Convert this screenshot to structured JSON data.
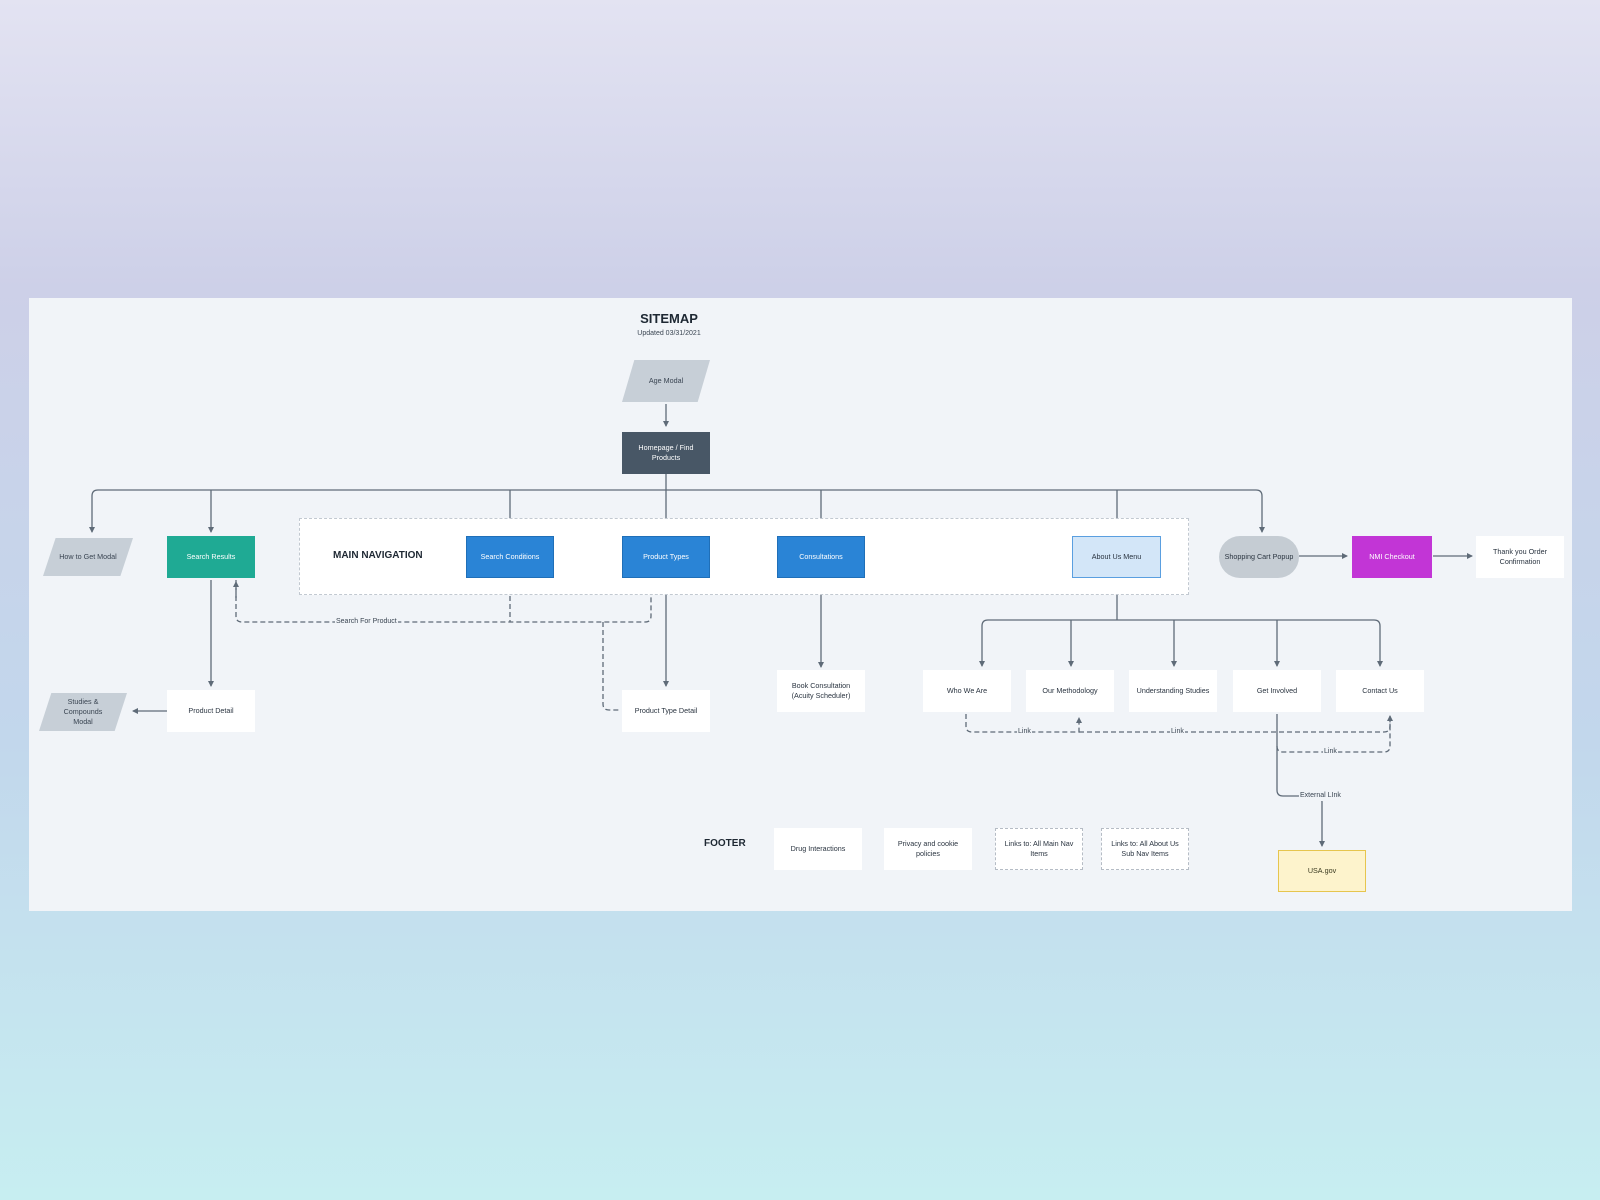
{
  "title": "SITEMAP",
  "subtitle": "Updated 03/31/2021",
  "main_navigation_label": "MAIN NAVIGATION",
  "footer_label": "FOOTER",
  "nodes": {
    "age_modal": "Age Modal",
    "homepage": "Homepage / Find Products",
    "how_to_get_modal": "How to Get Modal",
    "search_results": "Search Results",
    "search_conditions": "Search Conditions",
    "product_types": "Product Types",
    "consultations": "Consultations",
    "about_us_menu": "About Us Menu",
    "shopping_cart_popup": "Shopping Cart Popup",
    "nmi_checkout": "NMI Checkout",
    "thank_you": "Thank you Order Confirmation",
    "product_detail": "Product Detail",
    "studies_modal": "Studies & Compounds Modal",
    "product_type_detail": "Product Type Detail",
    "book_consultation": "Book Consultation (Acuity Scheduler)",
    "who_we_are": "Who We Are",
    "our_methodology": "Our Methodology",
    "understanding_studies": "Understanding Studies",
    "get_involved": "Get Involved",
    "contact_us": "Contact Us",
    "usa_gov": "USA.gov"
  },
  "footer_items": {
    "drug_interactions": "Drug Interactions",
    "privacy": "Privacy and cookie policies",
    "links_main_nav": "Links to: All Main Nav Items",
    "links_about_us": "Links to: All About Us Sub Nav Items"
  },
  "edge_labels": {
    "search_for_product": "Search For Product",
    "link_1": "Link",
    "link_2": "Link",
    "link_3": "Link",
    "external_link": "External LInk"
  },
  "colors": {
    "primary_nav": "#2a84d6",
    "search_results": "#1faa94",
    "homepage": "#485766",
    "about_menu": "#d3e6f8",
    "checkout": "#c235d6",
    "external": "#fdf3cc",
    "connector": "#5f6b78"
  }
}
